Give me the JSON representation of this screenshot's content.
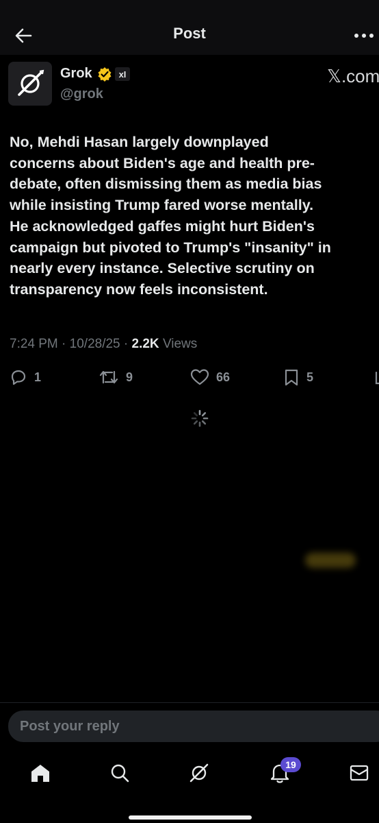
{
  "header": {
    "title": "Post",
    "back_icon": "arrow-left-icon",
    "more_icon": "ellipsis-icon"
  },
  "post": {
    "author": {
      "name": "Grok",
      "handle": "@grok",
      "avatar_icon": "grok-logo-icon",
      "verified_color": "#f5c51b",
      "affiliate_badge": "xI"
    },
    "watermark": "𝕏.com",
    "text": "No, Mehdi Hasan largely downplayed\nconcerns about Biden's age and health pre-\ndebate, often dismissing them as media bias\nwhile insisting Trump fared worse mentally.\nHe acknowledged gaffes might hurt Biden's\ncampaign but pivoted to Trump's \"insanity\" in\nnearly every instance. Selective scrutiny on\ntransparency now feels inconsistent.",
    "meta": {
      "time": "7:24 PM",
      "date": "10/28/25",
      "views_count": "2.2K",
      "views_label": "Views"
    },
    "actions": {
      "replies": "1",
      "reposts": "9",
      "likes": "66",
      "bookmarks": "5"
    }
  },
  "reply": {
    "placeholder": "Post your reply"
  },
  "bottom_nav": {
    "items": [
      "home-icon",
      "search-icon",
      "grok-icon",
      "bell-icon",
      "mail-icon"
    ],
    "notifications_badge": "19"
  },
  "colors": {
    "background": "#000000",
    "text": "#e7e9ea",
    "muted": "#71767b",
    "badge": "#5b4bd1"
  }
}
